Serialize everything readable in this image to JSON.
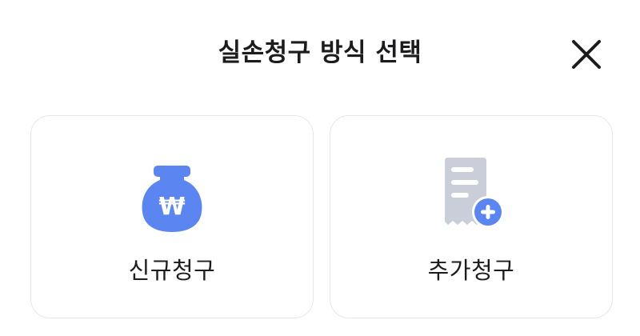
{
  "dialog": {
    "title": "실손청구 방식 선택",
    "close_icon": "close-icon"
  },
  "options": [
    {
      "label": "신규청구",
      "icon": "money-bag-won-icon",
      "icon_symbol": "₩"
    },
    {
      "label": "추가청구",
      "icon": "receipt-add-icon"
    }
  ],
  "colors": {
    "accent": "#5b86f2",
    "receipt": "#c9ced8",
    "receipt_lines": "#ffffff",
    "card_border": "#e6e7ec",
    "text": "#1c1c1e"
  }
}
